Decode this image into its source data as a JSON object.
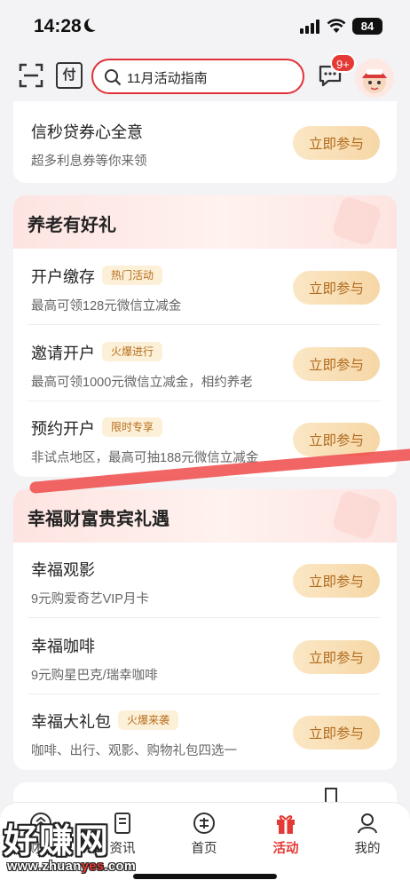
{
  "status_bar": {
    "time": "14:28",
    "battery": "84"
  },
  "header": {
    "pay_label": "付",
    "search_value": "11月活动指南",
    "message_badge": "9+"
  },
  "top_card": {
    "title": "信秒贷券心全意",
    "subtitle": "超多利息券等你来领",
    "button": "立即参与"
  },
  "pension_section": {
    "title": "养老有好礼",
    "items": [
      {
        "title": "开户缴存",
        "tag": "热门活动",
        "subtitle": "最高可领128元微信立减金",
        "button": "立即参与"
      },
      {
        "title": "邀请开户",
        "tag": "火爆进行",
        "subtitle": "最高可领1000元微信立减金，相约养老",
        "button": "立即参与"
      },
      {
        "title": "预约开户",
        "tag": "限时专享",
        "subtitle": "非试点地区，最高可抽188元微信立减金",
        "button": "立即参与"
      }
    ]
  },
  "vip_section": {
    "title": "幸福财富贵宾礼遇",
    "items": [
      {
        "title": "幸福观影",
        "tag": "",
        "subtitle": "9元购爱奇艺VIP月卡",
        "button": "立即参与"
      },
      {
        "title": "幸福咖啡",
        "tag": "",
        "subtitle": "9元购星巴克/瑞幸咖啡",
        "button": "立即参与"
      },
      {
        "title": "幸福大礼包",
        "tag": "火爆来袭",
        "subtitle": "咖啡、出行、观影、购物礼包四选一",
        "button": "立即参与"
      }
    ]
  },
  "bottom_nav": {
    "items": [
      {
        "label": "财富",
        "icon": "wealth-icon"
      },
      {
        "label": "资讯",
        "icon": "news-icon"
      },
      {
        "label": "首页",
        "icon": "home-logo-icon"
      },
      {
        "label": "活动",
        "icon": "gift-icon"
      },
      {
        "label": "我的",
        "icon": "profile-icon"
      }
    ],
    "active_color": "#e53935"
  },
  "watermark": {
    "big": "好赚网",
    "url_prefix": "www.zhuan",
    "url_accent": "yes",
    "url_suffix": ".com"
  },
  "colors": {
    "accent": "#e53935",
    "button_text": "#b06a1d",
    "tag_bg": "#fdf0d8"
  }
}
